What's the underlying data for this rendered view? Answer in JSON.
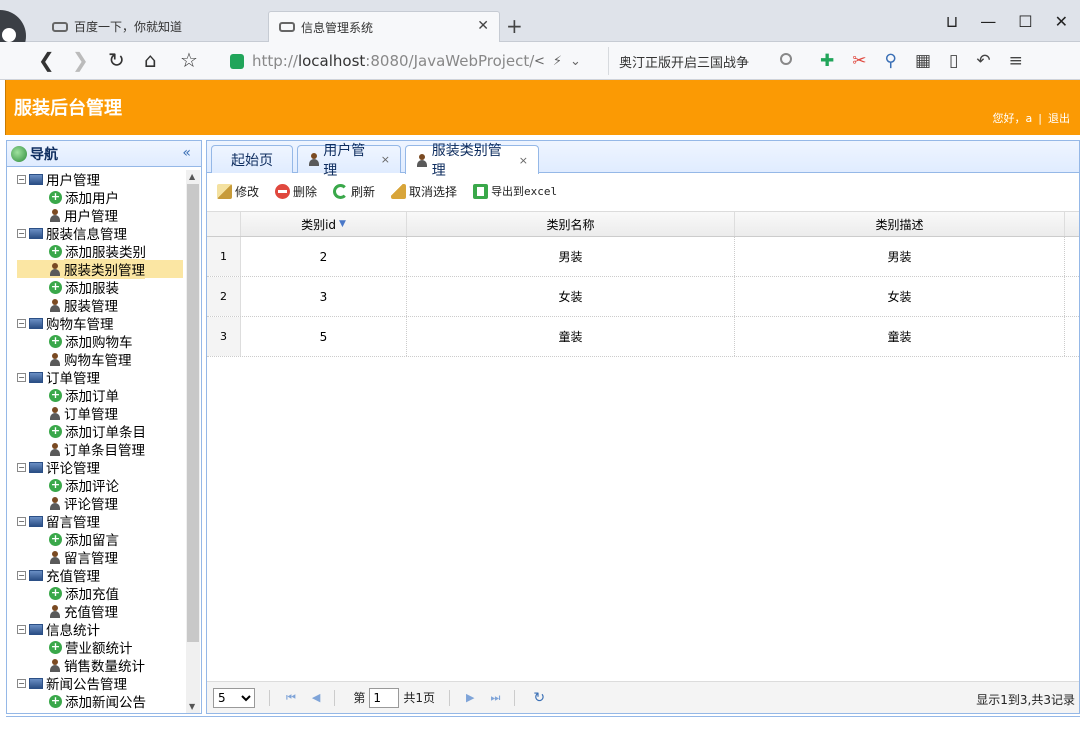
{
  "browser": {
    "tabs": [
      {
        "title": "百度一下，你就知道"
      },
      {
        "title": "信息管理系统"
      }
    ],
    "new_tab": "+",
    "window_buttons": [
      "⊔",
      "—",
      "☐",
      "✕"
    ],
    "address_scheme": "http://",
    "address_host": "localhost",
    "address_path": ":8080/JavaWebProject/",
    "search_text": "奥汀正版开启三国战争",
    "icons": [
      "back-icon",
      "forward-icon",
      "reload-icon",
      "home-icon",
      "star-icon"
    ]
  },
  "app": {
    "title": "服装后台管理",
    "greeting": "您好，a",
    "logout": "退出",
    "header_color": "#fb9a04"
  },
  "nav": {
    "title": "导航",
    "collapse": "«",
    "tree": [
      {
        "type": "group",
        "label": "用户管理"
      },
      {
        "type": "add",
        "label": "添加用户"
      },
      {
        "type": "manage",
        "label": "用户管理"
      },
      {
        "type": "group",
        "label": "服装信息管理"
      },
      {
        "type": "add",
        "label": "添加服装类别"
      },
      {
        "type": "manage",
        "label": "服装类别管理",
        "selected": true
      },
      {
        "type": "add",
        "label": "添加服装"
      },
      {
        "type": "manage",
        "label": "服装管理"
      },
      {
        "type": "group",
        "label": "购物车管理"
      },
      {
        "type": "add",
        "label": "添加购物车"
      },
      {
        "type": "manage",
        "label": "购物车管理"
      },
      {
        "type": "group",
        "label": "订单管理"
      },
      {
        "type": "add",
        "label": "添加订单"
      },
      {
        "type": "manage",
        "label": "订单管理"
      },
      {
        "type": "add",
        "label": "添加订单条目"
      },
      {
        "type": "manage",
        "label": "订单条目管理"
      },
      {
        "type": "group",
        "label": "评论管理"
      },
      {
        "type": "add",
        "label": "添加评论"
      },
      {
        "type": "manage",
        "label": "评论管理"
      },
      {
        "type": "group",
        "label": "留言管理"
      },
      {
        "type": "add",
        "label": "添加留言"
      },
      {
        "type": "manage",
        "label": "留言管理"
      },
      {
        "type": "group",
        "label": "充值管理"
      },
      {
        "type": "add",
        "label": "添加充值"
      },
      {
        "type": "manage",
        "label": "充值管理"
      },
      {
        "type": "group",
        "label": "信息统计"
      },
      {
        "type": "add",
        "label": "营业额统计"
      },
      {
        "type": "manage",
        "label": "销售数量统计"
      },
      {
        "type": "group",
        "label": "新闻公告管理"
      },
      {
        "type": "add",
        "label": "添加新闻公告"
      }
    ]
  },
  "main": {
    "tabs": [
      {
        "label": "起始页",
        "closable": false
      },
      {
        "label": "用户管理",
        "closable": true
      },
      {
        "label": "服装类别管理",
        "closable": true,
        "active": true
      }
    ],
    "toolbar": {
      "edit": "修改",
      "delete": "删除",
      "refresh": "刷新",
      "unselect": "取消选择",
      "export": "导出到excel"
    },
    "grid": {
      "columns": [
        "类别id",
        "类别名称",
        "类别描述"
      ],
      "sort_indicator": "▼",
      "rows": [
        {
          "rownum": "1",
          "id": "2",
          "name": "男装",
          "desc": "男装"
        },
        {
          "rownum": "2",
          "id": "3",
          "name": "女装",
          "desc": "女装"
        },
        {
          "rownum": "3",
          "id": "5",
          "name": "童装",
          "desc": "童装"
        }
      ]
    },
    "pager": {
      "page_size": "5",
      "page_label_before": "第",
      "page_value": "1",
      "page_label_after": "共1页",
      "info": "显示1到3,共3记录"
    }
  }
}
